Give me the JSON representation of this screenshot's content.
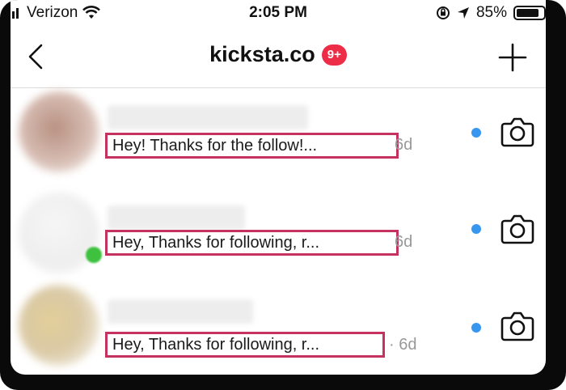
{
  "status": {
    "carrier": "Verizon",
    "time": "2:05 PM",
    "battery": "85%",
    "battery_fraction": 0.85
  },
  "header": {
    "title": "kicksta.co",
    "badge": "9+"
  },
  "threads": [
    {
      "preview": "Hey! Thanks for the follow!...",
      "time": "6d",
      "unread": true
    },
    {
      "preview": "Hey, Thanks for following, r...",
      "time": "6d",
      "unread": true
    },
    {
      "preview": "Hey, Thanks for following, r...",
      "time": "· 6d",
      "unread": true
    }
  ],
  "colors": {
    "highlight": "#c5325f",
    "badge": "#ed2d48",
    "unread_dot": "#3797f0"
  },
  "icons": [
    "back-chevron-icon",
    "plus-icon",
    "camera-icon",
    "wifi-icon",
    "location-arrow-icon",
    "orientation-lock-icon",
    "battery-icon"
  ]
}
